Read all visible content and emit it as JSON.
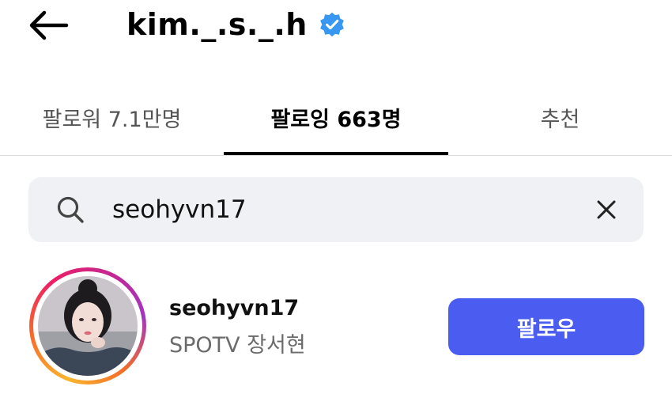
{
  "header": {
    "back_icon": "arrow-left-icon",
    "username": "kim._.s._.h",
    "verified_icon": "verified-badge-icon",
    "verified_color": "#3897f0"
  },
  "tabs": [
    {
      "label": "팔로워 7.1만명",
      "active": false
    },
    {
      "label": "팔로잉 663명",
      "active": true
    },
    {
      "label": "추천",
      "active": false
    }
  ],
  "search": {
    "icon": "search-icon",
    "value": "seohyvn17",
    "clear_icon": "close-icon"
  },
  "results": [
    {
      "username": "seohyvn17",
      "full_name": "SPOTV 장서현",
      "has_story_ring": true,
      "button_label": "팔로우",
      "button_color": "#4a5df0"
    }
  ]
}
